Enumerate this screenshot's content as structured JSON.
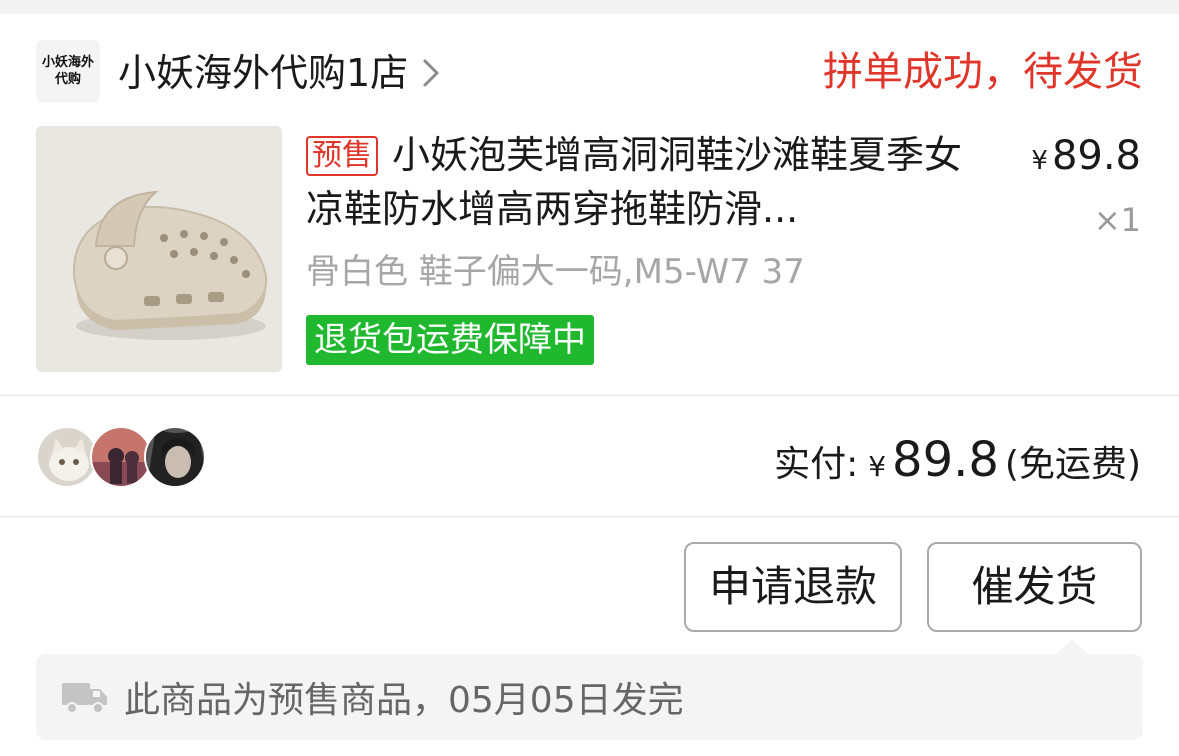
{
  "shop": {
    "logo_text": "小妖海外代购",
    "name": "小妖海外代购1店"
  },
  "order": {
    "status": "拼单成功，待发货"
  },
  "product": {
    "tag": "预售",
    "title": "小妖泡芙增高洞洞鞋沙滩鞋夏季女凉鞋防水增高两穿拖鞋防滑...",
    "price_symbol": "¥",
    "price": "89.8",
    "quantity": "×1",
    "sku": "骨白色 鞋子偏大一码,M5-W7 37",
    "guarantee": "退货包运费保障中"
  },
  "payment": {
    "label": "实付:",
    "symbol": "¥",
    "amount": "89.8",
    "note": "(免运费)"
  },
  "actions": {
    "refund_label": "申请退款",
    "urge_label": "催发货"
  },
  "notice": {
    "icon": "truck-icon",
    "text": "此商品为预售商品，05月05日发完"
  },
  "colors": {
    "status_red": "#e0352a",
    "guarantee_green": "#20b82e"
  }
}
